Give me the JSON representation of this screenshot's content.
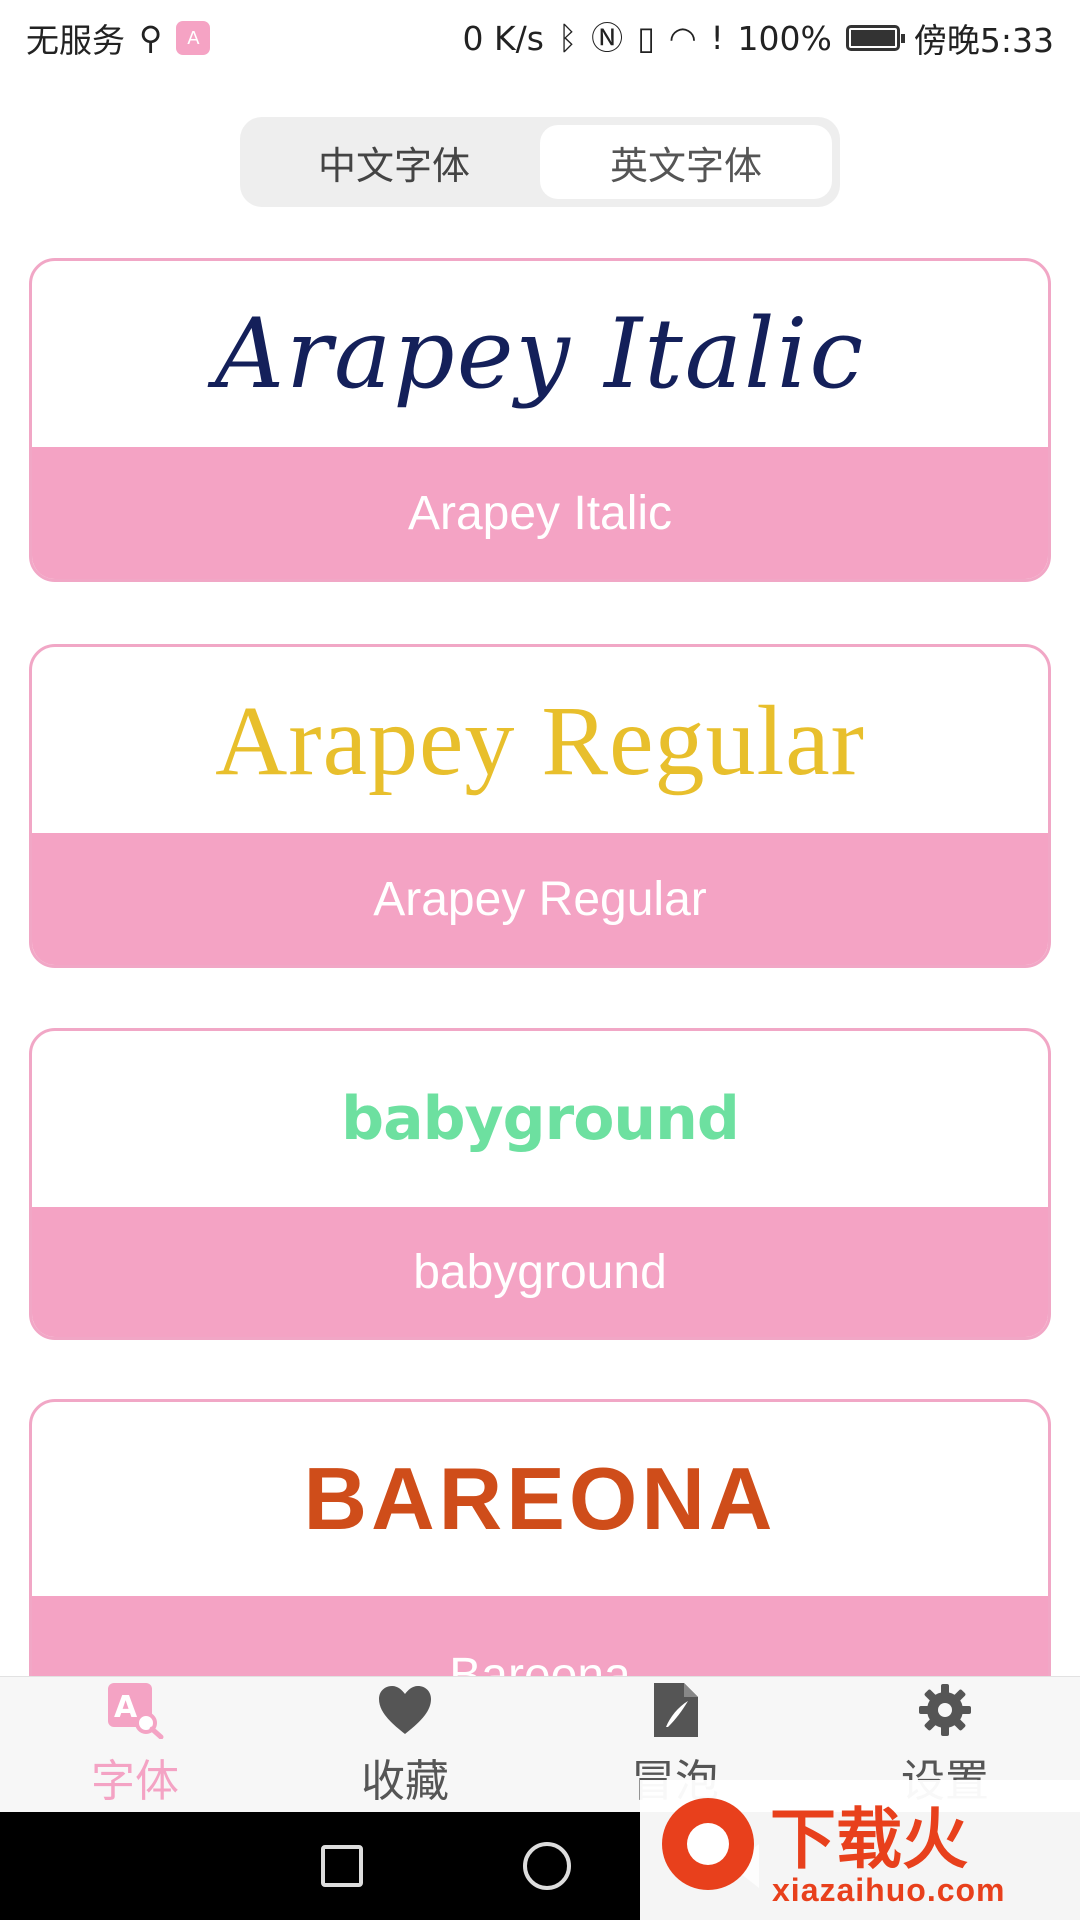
{
  "status_bar": {
    "carrier": "无服务",
    "net_speed": "0 K/s",
    "battery": "100%",
    "battery_level": 1.0,
    "time": "傍晚5:33",
    "icons": [
      "usb-icon",
      "app-icon",
      "bluetooth-icon",
      "nfc-icon",
      "vibrate-icon",
      "wifi-icon",
      "alert-icon",
      "battery-icon"
    ]
  },
  "tabs": {
    "chinese": "中文字体",
    "english": "英文字体",
    "selected": "english"
  },
  "fonts": [
    {
      "preview": "Arapey Italic",
      "name": "Arapey Italic",
      "color": "#14205a"
    },
    {
      "preview": "Arapey Regular",
      "name": "Arapey Regular",
      "color": "#e8bf2c"
    },
    {
      "preview": "babyground",
      "name": "babyground",
      "color": "#6de0a0"
    },
    {
      "preview": "BAREONA",
      "name": "Bareona",
      "color": "#cf4d1a"
    }
  ],
  "bottom_nav": {
    "items": [
      {
        "label": "字体",
        "icon": "font-search-icon",
        "active": true
      },
      {
        "label": "收藏",
        "icon": "heart-icon",
        "active": false
      },
      {
        "label": "冒泡",
        "icon": "quill-document-icon",
        "active": false
      },
      {
        "label": "设置",
        "icon": "gear-icon",
        "active": false
      }
    ]
  },
  "watermark": {
    "title": "下载火",
    "url": "xiazaihuo.com"
  },
  "colors": {
    "accent": "#f4a3c4",
    "card_border": "#f1a7c6"
  }
}
